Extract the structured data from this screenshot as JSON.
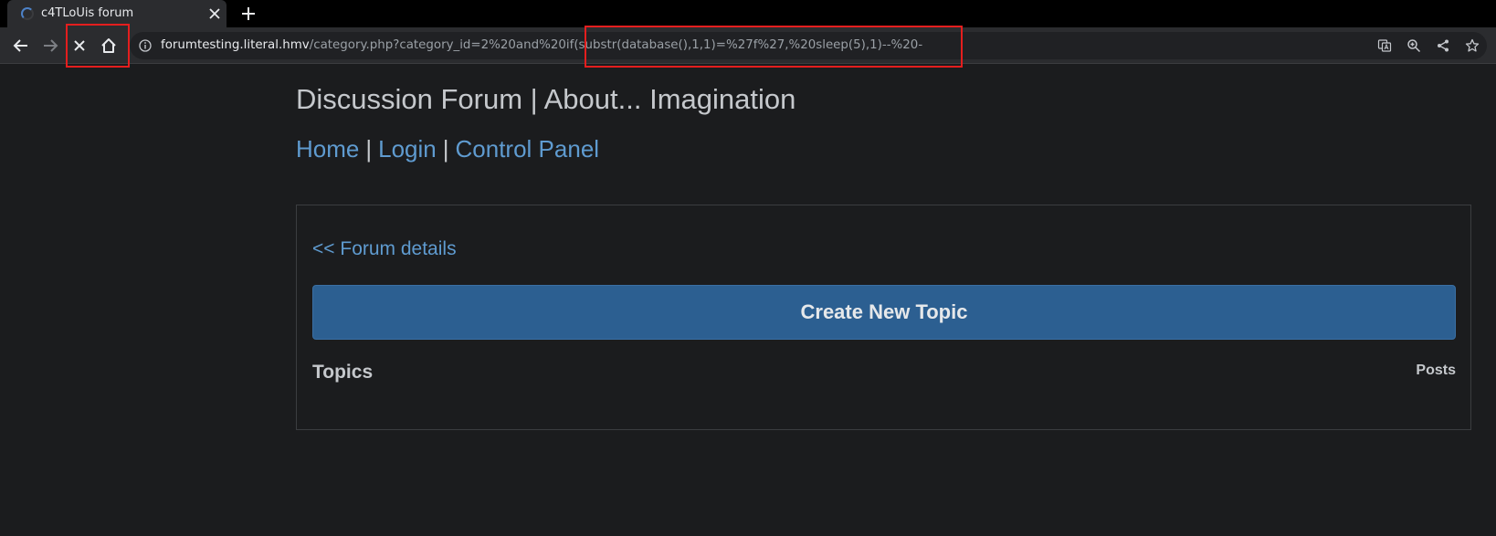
{
  "browser": {
    "tab": {
      "title": "c4TLoUis forum",
      "loading": true
    },
    "url": {
      "host": "forumtesting.literal.hmv",
      "path": "/category.php?category_id=2%20and%20if(substr(database(),1,1)=%27f%27,%20sleep(5),1)--%20-"
    },
    "icons": {
      "back": "back-arrow-icon",
      "forward": "forward-arrow-icon",
      "stop": "stop-loading-icon",
      "home": "home-icon",
      "info": "site-info-icon",
      "translate": "translate-icon",
      "zoom": "zoom-icon",
      "share": "share-icon",
      "bookmark": "star-icon"
    },
    "highlight_color": "#e41e1e"
  },
  "page": {
    "site_title": "Discussion Forum | About... Imagination",
    "nav": {
      "home": "Home",
      "login": "Login",
      "control_panel": "Control Panel",
      "separator": "|"
    },
    "back_link": "<< Forum details",
    "create_button": "Create New Topic",
    "table": {
      "topics_header": "Topics",
      "posts_header": "Posts"
    }
  },
  "colors": {
    "link": "#5f9bd0",
    "button": "#2c5f91",
    "background": "#1b1c1e",
    "text": "#c5c8cc"
  }
}
